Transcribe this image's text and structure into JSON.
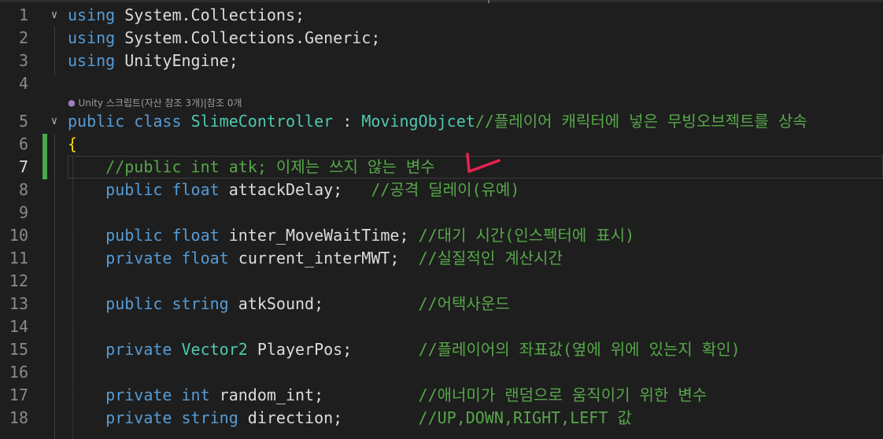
{
  "editor": {
    "colors": {
      "background": "#1e1e1e",
      "keyword": "#569cd6",
      "type": "#4ec9b0",
      "comment": "#57a64a",
      "text": "#dcdcdc",
      "line_number": "#8a8a8a",
      "change_bar": "#48a84e",
      "annotation_mark": "#e8224e"
    },
    "codelens": {
      "icon": "unity-script-icon",
      "text": "Unity 스크립트(자산 참조 3개)|참조 0개"
    },
    "lines": [
      {
        "num": "1",
        "fold": "∨",
        "parts": [
          {
            "c": "kw",
            "t": "using"
          },
          {
            "c": "txt",
            "t": " System.Collections;"
          }
        ]
      },
      {
        "num": "2",
        "parts": [
          {
            "c": "kw",
            "t": "using"
          },
          {
            "c": "txt",
            "t": " System.Collections.Generic;"
          }
        ]
      },
      {
        "num": "3",
        "parts": [
          {
            "c": "kw",
            "t": "using"
          },
          {
            "c": "txt",
            "t": " UnityEngine;"
          }
        ]
      },
      {
        "num": "4",
        "parts": []
      },
      {
        "num": "5",
        "fold": "∨",
        "parts": [
          {
            "c": "kw",
            "t": "public"
          },
          {
            "c": "txt",
            "t": " "
          },
          {
            "c": "kw",
            "t": "class"
          },
          {
            "c": "txt",
            "t": " "
          },
          {
            "c": "type",
            "t": "SlimeController"
          },
          {
            "c": "txt",
            "t": " : "
          },
          {
            "c": "type",
            "t": "MovingObjcet"
          },
          {
            "c": "cmt",
            "t": "//플레이어 캐릭터에 넣은 무빙오브젝트를 상속"
          }
        ]
      },
      {
        "num": "6",
        "parts": [
          {
            "c": "brace",
            "t": "{"
          }
        ]
      },
      {
        "num": "7",
        "current": true,
        "parts": [
          {
            "c": "txt",
            "t": "    "
          },
          {
            "c": "cmt",
            "t": "//public int atk; 이제는 쓰지 않는 변수"
          }
        ]
      },
      {
        "num": "8",
        "parts": [
          {
            "c": "txt",
            "t": "    "
          },
          {
            "c": "kw",
            "t": "public"
          },
          {
            "c": "txt",
            "t": " "
          },
          {
            "c": "kw",
            "t": "float"
          },
          {
            "c": "txt",
            "t": " attackDelay;   "
          },
          {
            "c": "cmt",
            "t": "//공격 딜레이(유예)"
          }
        ]
      },
      {
        "num": "9",
        "parts": []
      },
      {
        "num": "10",
        "parts": [
          {
            "c": "txt",
            "t": "    "
          },
          {
            "c": "kw",
            "t": "public"
          },
          {
            "c": "txt",
            "t": " "
          },
          {
            "c": "kw",
            "t": "float"
          },
          {
            "c": "txt",
            "t": " inter_MoveWaitTime; "
          },
          {
            "c": "cmt",
            "t": "//대기 시간(인스펙터에 표시)"
          }
        ]
      },
      {
        "num": "11",
        "parts": [
          {
            "c": "txt",
            "t": "    "
          },
          {
            "c": "kw",
            "t": "private"
          },
          {
            "c": "txt",
            "t": " "
          },
          {
            "c": "kw",
            "t": "float"
          },
          {
            "c": "txt",
            "t": " current_interMWT;  "
          },
          {
            "c": "cmt",
            "t": "//실질적인 계산시간"
          }
        ]
      },
      {
        "num": "12",
        "parts": []
      },
      {
        "num": "13",
        "parts": [
          {
            "c": "txt",
            "t": "    "
          },
          {
            "c": "kw",
            "t": "public"
          },
          {
            "c": "txt",
            "t": " "
          },
          {
            "c": "kw",
            "t": "string"
          },
          {
            "c": "txt",
            "t": " atkSound;          "
          },
          {
            "c": "cmt",
            "t": "//어택사운드"
          }
        ]
      },
      {
        "num": "14",
        "parts": []
      },
      {
        "num": "15",
        "parts": [
          {
            "c": "txt",
            "t": "    "
          },
          {
            "c": "kw",
            "t": "private"
          },
          {
            "c": "txt",
            "t": " "
          },
          {
            "c": "type",
            "t": "Vector2"
          },
          {
            "c": "txt",
            "t": " PlayerPos;       "
          },
          {
            "c": "cmt",
            "t": "//플레이어의 좌표값(옆에 위에 있는지 확인)"
          }
        ]
      },
      {
        "num": "16",
        "parts": []
      },
      {
        "num": "17",
        "parts": [
          {
            "c": "txt",
            "t": "    "
          },
          {
            "c": "kw",
            "t": "private"
          },
          {
            "c": "txt",
            "t": " "
          },
          {
            "c": "kw",
            "t": "int"
          },
          {
            "c": "txt",
            "t": " random_int;          "
          },
          {
            "c": "cmt",
            "t": "//애너미가 랜덤으로 움직이기 위한 변수"
          }
        ]
      },
      {
        "num": "18",
        "parts": [
          {
            "c": "txt",
            "t": "    "
          },
          {
            "c": "kw",
            "t": "private"
          },
          {
            "c": "txt",
            "t": " "
          },
          {
            "c": "kw",
            "t": "string"
          },
          {
            "c": "txt",
            "t": " direction;        "
          },
          {
            "c": "cmt",
            "t": "//UP,DOWN,RIGHT,LEFT 값"
          }
        ]
      }
    ]
  }
}
